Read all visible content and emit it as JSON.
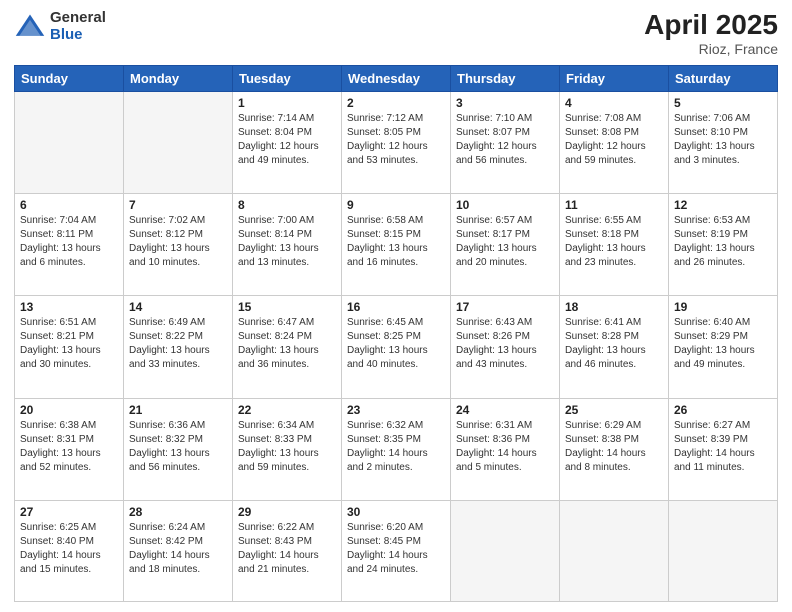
{
  "header": {
    "logo_general": "General",
    "logo_blue": "Blue",
    "month_title": "April 2025",
    "location": "Rioz, France"
  },
  "weekdays": [
    "Sunday",
    "Monday",
    "Tuesday",
    "Wednesday",
    "Thursday",
    "Friday",
    "Saturday"
  ],
  "weeks": [
    [
      {
        "day": "",
        "sunrise": "",
        "sunset": "",
        "daylight": ""
      },
      {
        "day": "",
        "sunrise": "",
        "sunset": "",
        "daylight": ""
      },
      {
        "day": "1",
        "sunrise": "Sunrise: 7:14 AM",
        "sunset": "Sunset: 8:04 PM",
        "daylight": "Daylight: 12 hours and 49 minutes."
      },
      {
        "day": "2",
        "sunrise": "Sunrise: 7:12 AM",
        "sunset": "Sunset: 8:05 PM",
        "daylight": "Daylight: 12 hours and 53 minutes."
      },
      {
        "day": "3",
        "sunrise": "Sunrise: 7:10 AM",
        "sunset": "Sunset: 8:07 PM",
        "daylight": "Daylight: 12 hours and 56 minutes."
      },
      {
        "day": "4",
        "sunrise": "Sunrise: 7:08 AM",
        "sunset": "Sunset: 8:08 PM",
        "daylight": "Daylight: 12 hours and 59 minutes."
      },
      {
        "day": "5",
        "sunrise": "Sunrise: 7:06 AM",
        "sunset": "Sunset: 8:10 PM",
        "daylight": "Daylight: 13 hours and 3 minutes."
      }
    ],
    [
      {
        "day": "6",
        "sunrise": "Sunrise: 7:04 AM",
        "sunset": "Sunset: 8:11 PM",
        "daylight": "Daylight: 13 hours and 6 minutes."
      },
      {
        "day": "7",
        "sunrise": "Sunrise: 7:02 AM",
        "sunset": "Sunset: 8:12 PM",
        "daylight": "Daylight: 13 hours and 10 minutes."
      },
      {
        "day": "8",
        "sunrise": "Sunrise: 7:00 AM",
        "sunset": "Sunset: 8:14 PM",
        "daylight": "Daylight: 13 hours and 13 minutes."
      },
      {
        "day": "9",
        "sunrise": "Sunrise: 6:58 AM",
        "sunset": "Sunset: 8:15 PM",
        "daylight": "Daylight: 13 hours and 16 minutes."
      },
      {
        "day": "10",
        "sunrise": "Sunrise: 6:57 AM",
        "sunset": "Sunset: 8:17 PM",
        "daylight": "Daylight: 13 hours and 20 minutes."
      },
      {
        "day": "11",
        "sunrise": "Sunrise: 6:55 AM",
        "sunset": "Sunset: 8:18 PM",
        "daylight": "Daylight: 13 hours and 23 minutes."
      },
      {
        "day": "12",
        "sunrise": "Sunrise: 6:53 AM",
        "sunset": "Sunset: 8:19 PM",
        "daylight": "Daylight: 13 hours and 26 minutes."
      }
    ],
    [
      {
        "day": "13",
        "sunrise": "Sunrise: 6:51 AM",
        "sunset": "Sunset: 8:21 PM",
        "daylight": "Daylight: 13 hours and 30 minutes."
      },
      {
        "day": "14",
        "sunrise": "Sunrise: 6:49 AM",
        "sunset": "Sunset: 8:22 PM",
        "daylight": "Daylight: 13 hours and 33 minutes."
      },
      {
        "day": "15",
        "sunrise": "Sunrise: 6:47 AM",
        "sunset": "Sunset: 8:24 PM",
        "daylight": "Daylight: 13 hours and 36 minutes."
      },
      {
        "day": "16",
        "sunrise": "Sunrise: 6:45 AM",
        "sunset": "Sunset: 8:25 PM",
        "daylight": "Daylight: 13 hours and 40 minutes."
      },
      {
        "day": "17",
        "sunrise": "Sunrise: 6:43 AM",
        "sunset": "Sunset: 8:26 PM",
        "daylight": "Daylight: 13 hours and 43 minutes."
      },
      {
        "day": "18",
        "sunrise": "Sunrise: 6:41 AM",
        "sunset": "Sunset: 8:28 PM",
        "daylight": "Daylight: 13 hours and 46 minutes."
      },
      {
        "day": "19",
        "sunrise": "Sunrise: 6:40 AM",
        "sunset": "Sunset: 8:29 PM",
        "daylight": "Daylight: 13 hours and 49 minutes."
      }
    ],
    [
      {
        "day": "20",
        "sunrise": "Sunrise: 6:38 AM",
        "sunset": "Sunset: 8:31 PM",
        "daylight": "Daylight: 13 hours and 52 minutes."
      },
      {
        "day": "21",
        "sunrise": "Sunrise: 6:36 AM",
        "sunset": "Sunset: 8:32 PM",
        "daylight": "Daylight: 13 hours and 56 minutes."
      },
      {
        "day": "22",
        "sunrise": "Sunrise: 6:34 AM",
        "sunset": "Sunset: 8:33 PM",
        "daylight": "Daylight: 13 hours and 59 minutes."
      },
      {
        "day": "23",
        "sunrise": "Sunrise: 6:32 AM",
        "sunset": "Sunset: 8:35 PM",
        "daylight": "Daylight: 14 hours and 2 minutes."
      },
      {
        "day": "24",
        "sunrise": "Sunrise: 6:31 AM",
        "sunset": "Sunset: 8:36 PM",
        "daylight": "Daylight: 14 hours and 5 minutes."
      },
      {
        "day": "25",
        "sunrise": "Sunrise: 6:29 AM",
        "sunset": "Sunset: 8:38 PM",
        "daylight": "Daylight: 14 hours and 8 minutes."
      },
      {
        "day": "26",
        "sunrise": "Sunrise: 6:27 AM",
        "sunset": "Sunset: 8:39 PM",
        "daylight": "Daylight: 14 hours and 11 minutes."
      }
    ],
    [
      {
        "day": "27",
        "sunrise": "Sunrise: 6:25 AM",
        "sunset": "Sunset: 8:40 PM",
        "daylight": "Daylight: 14 hours and 15 minutes."
      },
      {
        "day": "28",
        "sunrise": "Sunrise: 6:24 AM",
        "sunset": "Sunset: 8:42 PM",
        "daylight": "Daylight: 14 hours and 18 minutes."
      },
      {
        "day": "29",
        "sunrise": "Sunrise: 6:22 AM",
        "sunset": "Sunset: 8:43 PM",
        "daylight": "Daylight: 14 hours and 21 minutes."
      },
      {
        "day": "30",
        "sunrise": "Sunrise: 6:20 AM",
        "sunset": "Sunset: 8:45 PM",
        "daylight": "Daylight: 14 hours and 24 minutes."
      },
      {
        "day": "",
        "sunrise": "",
        "sunset": "",
        "daylight": ""
      },
      {
        "day": "",
        "sunrise": "",
        "sunset": "",
        "daylight": ""
      },
      {
        "day": "",
        "sunrise": "",
        "sunset": "",
        "daylight": ""
      }
    ]
  ]
}
